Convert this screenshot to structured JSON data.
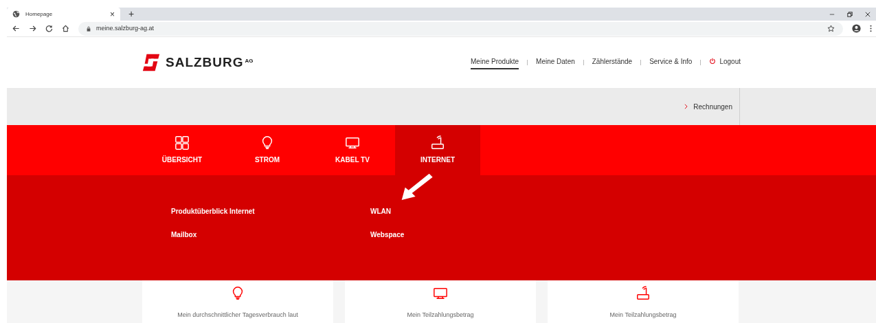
{
  "browser": {
    "tab": {
      "title": "Homepage",
      "close": "×",
      "new_tab": "+"
    },
    "address": "meine.salzburg-ag.at"
  },
  "header": {
    "logo": {
      "name": "SALZBURG",
      "suffix": "AG"
    },
    "nav": [
      {
        "label": "Meine Produkte",
        "selected": true,
        "kind": "link"
      },
      {
        "label": "Meine Daten",
        "selected": false,
        "kind": "link"
      },
      {
        "label": "Zählerstände",
        "selected": false,
        "kind": "link"
      },
      {
        "label": "Service & Info",
        "selected": false,
        "kind": "link"
      },
      {
        "label": "Logout",
        "selected": false,
        "kind": "logout"
      }
    ]
  },
  "subbar": {
    "link": "Rechnungen"
  },
  "product_tabs": [
    {
      "label": "ÜBERSICHT",
      "kind": "grid",
      "selected": false
    },
    {
      "label": "STROM",
      "kind": "bulb",
      "selected": false
    },
    {
      "label": "KABEL TV",
      "kind": "tv",
      "selected": false
    },
    {
      "label": "INTERNET",
      "kind": "router",
      "selected": true
    }
  ],
  "dropdown": {
    "columns": [
      [
        "Produktüberblick Internet",
        "Mailbox"
      ],
      [
        "WLAN",
        "Webspace"
      ]
    ]
  },
  "cards": [
    {
      "kind": "bulb",
      "text": "Mein durchschnittlicher Tagesverbrauch laut"
    },
    {
      "kind": "tv",
      "text": "Mein Teilzahlungsbetrag"
    },
    {
      "kind": "router",
      "text": "Mein Teilzahlungsbetrag"
    }
  ]
}
